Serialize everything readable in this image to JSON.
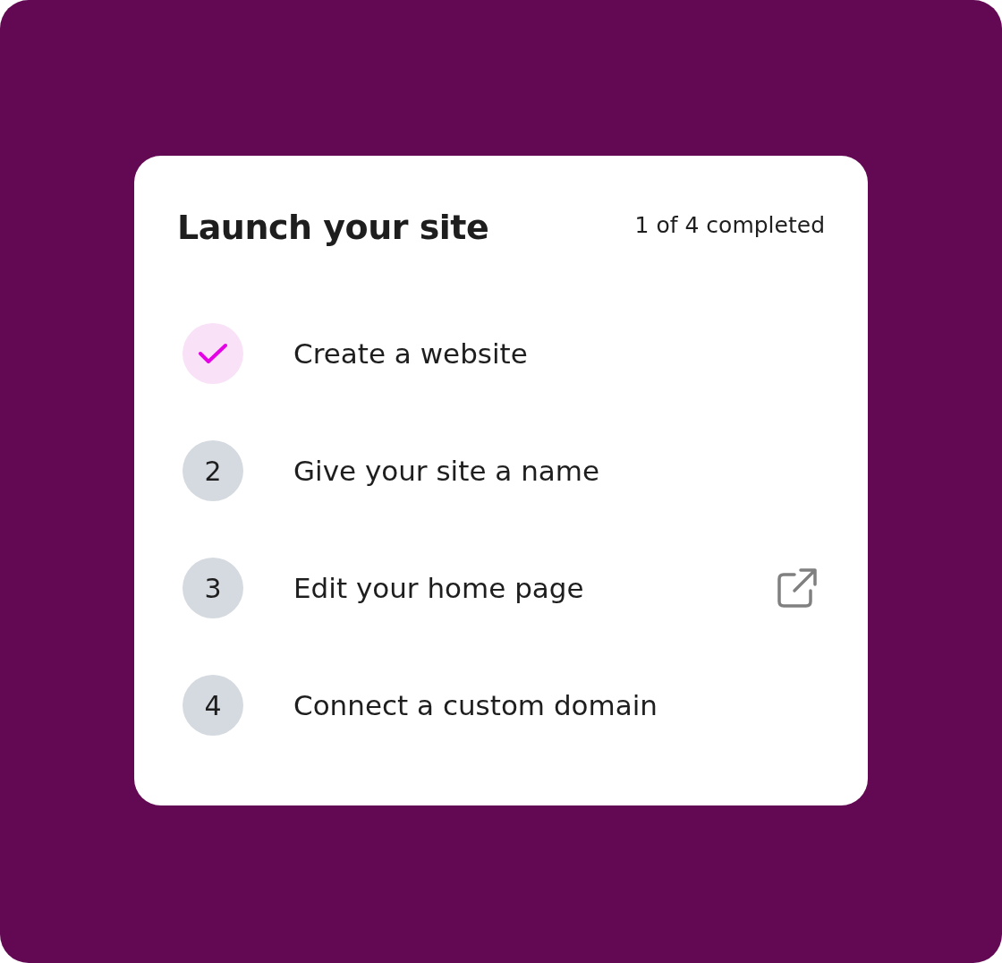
{
  "card": {
    "title": "Launch your site",
    "progress": "1 of 4 completed"
  },
  "steps": [
    {
      "label": "Create a website",
      "completed": true,
      "external_link": false
    },
    {
      "label": "Give your site a name",
      "number": "2",
      "completed": false,
      "external_link": false
    },
    {
      "label": "Edit your home page",
      "number": "3",
      "completed": false,
      "external_link": true
    },
    {
      "label": "Connect a custom domain",
      "number": "4",
      "completed": false,
      "external_link": false
    }
  ]
}
